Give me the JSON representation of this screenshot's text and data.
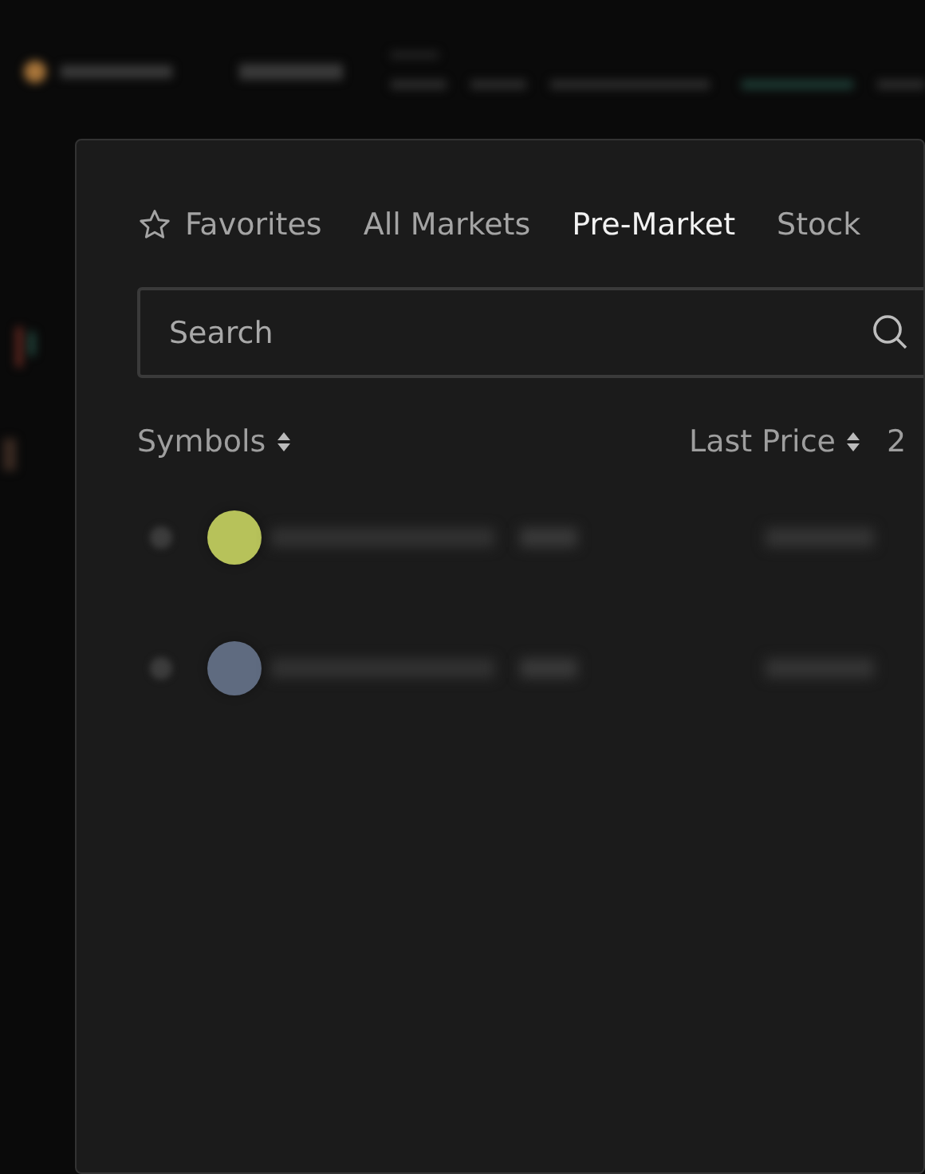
{
  "tabs": [
    {
      "label": "Favorites",
      "kind": "favorites",
      "selected": false
    },
    {
      "label": "All Markets",
      "kind": "plain",
      "selected": false
    },
    {
      "label": "Pre-Market",
      "kind": "plain",
      "selected": true
    },
    {
      "label": "Stock",
      "kind": "plain",
      "selected": false
    }
  ],
  "search": {
    "placeholder": "Search"
  },
  "table": {
    "columns": [
      {
        "label": "Symbols",
        "kind": "sortable"
      },
      {
        "label": "Last Price",
        "kind": "sortable"
      },
      {
        "label": "2",
        "kind": "cut"
      }
    ],
    "rows": [
      {
        "color": "#b7c25a"
      },
      {
        "color": "#5f6b80"
      }
    ]
  }
}
